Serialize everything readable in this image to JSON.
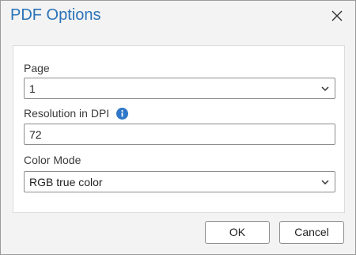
{
  "dialog": {
    "title": "PDF Options",
    "close_icon": "close-icon"
  },
  "fields": {
    "page": {
      "label": "Page",
      "value": "1"
    },
    "resolution": {
      "label": "Resolution in DPI",
      "value": "72",
      "info_icon": "info-icon"
    },
    "color_mode": {
      "label": "Color Mode",
      "value": "RGB true color"
    }
  },
  "buttons": {
    "ok": "OK",
    "cancel": "Cancel"
  },
  "colors": {
    "title": "#2b73b8",
    "info_icon": "#2f77c8",
    "dialog_bg": "#f3f3f3",
    "panel_bg": "#ffffff"
  }
}
